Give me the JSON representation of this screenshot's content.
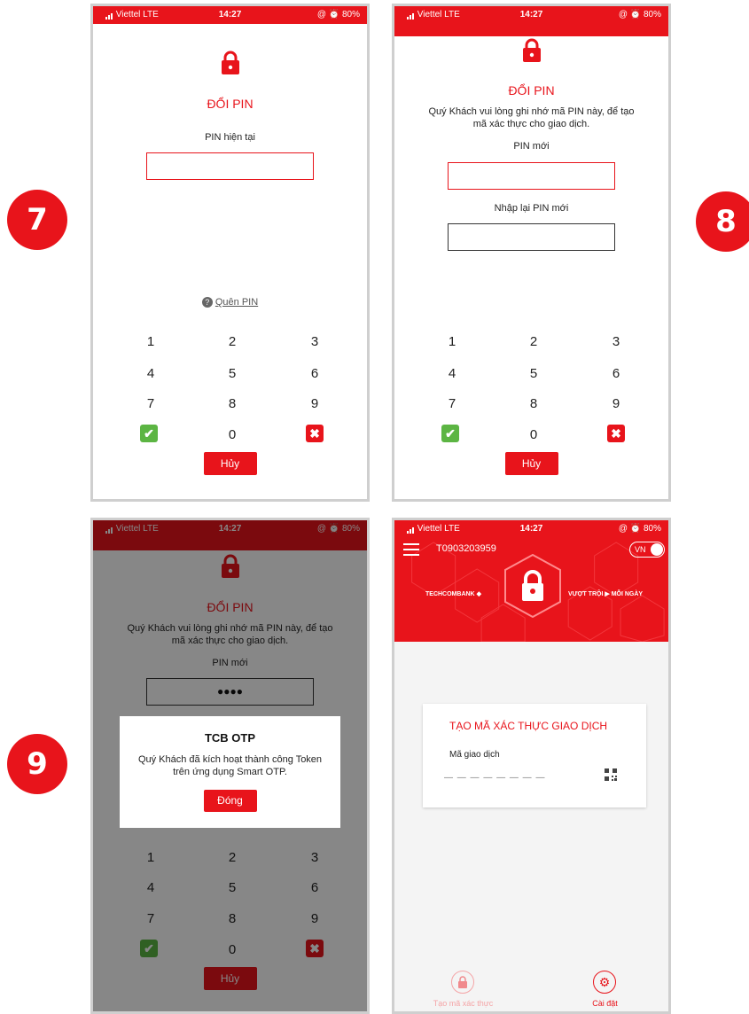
{
  "badges": {
    "b7": "7",
    "b8": "8",
    "b9": "9"
  },
  "status": {
    "carrier": "Viettel LTE",
    "time": "14:27",
    "battery": "@ ⏰ 80%"
  },
  "screen7": {
    "title": "ĐỔI PIN",
    "pin_label": "PIN hiện tại",
    "forgot_pin": "Quên PIN",
    "keys": [
      "1",
      "2",
      "3",
      "4",
      "5",
      "6",
      "7",
      "8",
      "9",
      "0"
    ],
    "cancel": "Hủy"
  },
  "screen8": {
    "title": "ĐỔI PIN",
    "note": "Quý Khách vui lòng ghi nhớ mã PIN này, để tạo mã xác thực cho giao dịch.",
    "new_pin_label": "PIN mới",
    "confirm_pin_label": "Nhập lại PIN mới",
    "keys": [
      "1",
      "2",
      "3",
      "4",
      "5",
      "6",
      "7",
      "8",
      "9",
      "0"
    ],
    "cancel": "Hủy"
  },
  "screen9": {
    "title": "ĐỔI PIN",
    "note": "Quý Khách vui lòng ghi nhớ mã PIN này, để tạo mã xác thực cho giao dịch.",
    "new_pin_label": "PIN mới",
    "pin_value": "●●●●",
    "keys": [
      "1",
      "2",
      "3",
      "4",
      "5",
      "6",
      "7",
      "8",
      "9",
      "0"
    ],
    "cancel": "Hủy",
    "dialog": {
      "title": "TCB OTP",
      "message": "Quý Khách đã kích hoạt thành công Token trên ứng dụng Smart OTP.",
      "close": "Đóng"
    }
  },
  "screen10": {
    "phone_id": "T0903203959",
    "lang": "VN",
    "brand": "TECHCOMBANK",
    "slogan": "VƯỢT TRỘI",
    "slogan2": "MỖI NGÀY",
    "card_title": "TẠO MÃ XÁC THỰC GIAO DỊCH",
    "code_label": "Mã giao dịch",
    "code_placeholder": "— — — — — — — —",
    "tab_create": "Tạo mã xác thực",
    "tab_settings": "Cài đặt"
  },
  "colors": {
    "accent": "#e8141b",
    "ok": "#5cb543",
    "status_red": "#e8141b"
  },
  "icons": [
    "lock-icon",
    "help-icon",
    "check-icon",
    "close-icon",
    "menu-icon",
    "qr-icon",
    "gear-icon"
  ]
}
